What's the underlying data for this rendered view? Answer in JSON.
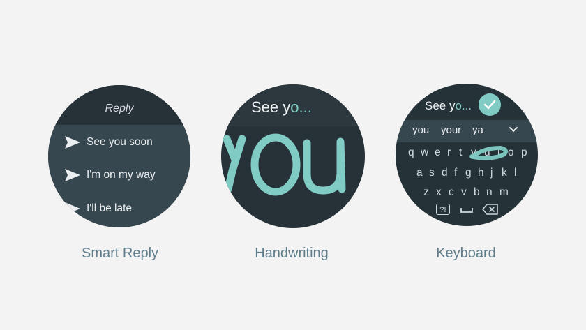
{
  "smart_reply": {
    "header": "Reply",
    "items": [
      "See you soon",
      "I'm on my way",
      "I'll be late"
    ],
    "caption": "Smart Reply"
  },
  "handwriting": {
    "prompt_prefix": "See y",
    "prompt_tail": "o...",
    "ink_text": "you",
    "caption": "Handwriting"
  },
  "keyboard": {
    "prompt_prefix": "See y",
    "prompt_tail": "o...",
    "suggestions": [
      "you",
      "your",
      "ya"
    ],
    "row1": [
      "q",
      "w",
      "e",
      "r",
      "t",
      "y",
      "u",
      "i",
      "o",
      "p"
    ],
    "row2": [
      "a",
      "s",
      "d",
      "f",
      "g",
      "h",
      "j",
      "k",
      "l"
    ],
    "row3": [
      "z",
      "x",
      "c",
      "v",
      "b",
      "n",
      "m"
    ],
    "symbols_key": "?!",
    "caption": "Keyboard"
  },
  "colors": {
    "background": "#f3f3f3",
    "watch_dark": "#263238",
    "watch_mid": "#37474f",
    "accent_teal": "#80cbc4",
    "caption": "#607d8b"
  },
  "icons": [
    "send-icon",
    "check-icon",
    "chevron-down-icon",
    "space-icon",
    "backspace-icon"
  ]
}
